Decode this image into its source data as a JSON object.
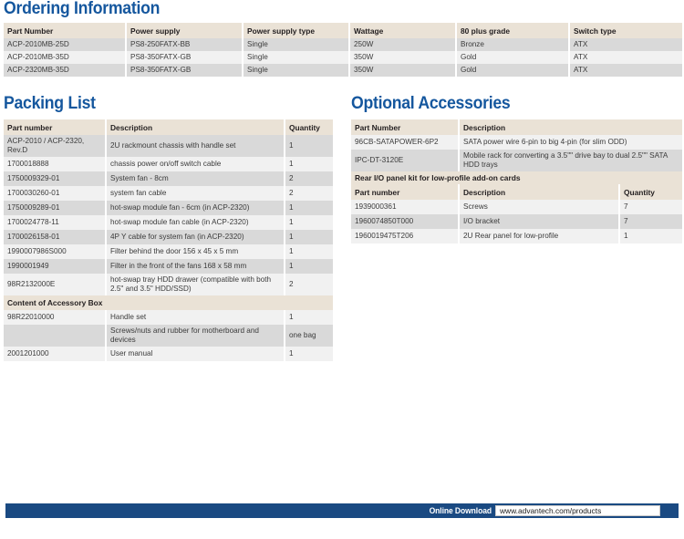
{
  "ordering": {
    "title": "Ordering Information",
    "columns": [
      "Part Number",
      "Power supply",
      "Power supply type",
      "Wattage",
      "80 plus grade",
      "Switch type"
    ],
    "rows": [
      [
        "ACP-2010MB-25D",
        "PS8-250FATX-BB",
        "Single",
        "250W",
        "Bronze",
        "ATX"
      ],
      [
        "ACP-2010MB-35D",
        "PS8-350FATX-GB",
        "Single",
        "350W",
        "Gold",
        "ATX"
      ],
      [
        "ACP-2320MB-35D",
        "PS8-350FATX-GB",
        "Single",
        "350W",
        "Gold",
        "ATX"
      ]
    ]
  },
  "packing": {
    "title": "Packing List",
    "columns": [
      "Part number",
      "Description",
      "Quantity"
    ],
    "rows": [
      [
        "ACP-2010 / ACP-2320, Rev.D",
        "2U rackmount chassis with handle set",
        "1"
      ],
      [
        "1700018888",
        "chassis power on/off switch cable",
        "1"
      ],
      [
        "1750009329-01",
        "System fan - 8cm",
        "2"
      ],
      [
        "1700030260-01",
        "system fan cable",
        "2"
      ],
      [
        "1750009289-01",
        "hot-swap module fan - 6cm (in ACP-2320)",
        "1"
      ],
      [
        "1700024778-11",
        "hot-swap module fan cable (in ACP-2320)",
        "1"
      ],
      [
        "1700026158-01",
        "4P Y cable for system fan (in ACP-2320)",
        "1"
      ],
      [
        "1990007986S000",
        "Filter behind the door 156 x 45 x 5 mm",
        "1"
      ],
      [
        "1990001949",
        "Filter in the front of the fans 168 x 58 mm",
        "1"
      ],
      [
        "98R2132000E",
        "hot-swap tray HDD drawer (compatible with both 2.5\" and 3.5\" HDD/SSD)",
        "2"
      ]
    ],
    "accessory_box_title": "Content of Accessory Box",
    "accessory_rows": [
      [
        "98R22010000",
        "Handle set",
        "1"
      ],
      [
        "",
        "Screws/nuts and rubber for motherboard and devices",
        "one bag"
      ],
      [
        "2001201000",
        "User manual",
        "1"
      ]
    ]
  },
  "optional": {
    "title": "Optional Accessories",
    "columns": [
      "Part Number",
      "Description"
    ],
    "rows": [
      [
        "96CB-SATAPOWER-6P2",
        "SATA power wire 6-pin to big 4-pin (for slim ODD)"
      ],
      [
        "IPC-DT-3120E",
        "Mobile rack for converting a 3.5\"\" drive bay to dual 2.5\"\" SATA HDD trays"
      ]
    ],
    "rear_kit_title": "Rear I/O panel kit for low-profile add-on cards",
    "rear_columns": [
      "Part number",
      "Description",
      "Quantity"
    ],
    "rear_rows": [
      [
        "1939000361",
        "Screws",
        "7"
      ],
      [
        "1960074850T000",
        "I/O bracket",
        "7"
      ],
      [
        "1960019475T206",
        "2U Rear panel for low-profile",
        "1"
      ]
    ]
  },
  "footer": {
    "label": "Online Download",
    "url": "www.advantech.com/products"
  },
  "colors": {
    "heading_blue": "#15579e",
    "footer_blue": "#1a4a82",
    "table_header_beige": "#eae2d6",
    "row_odd": "#d9d9d9",
    "row_even": "#f1f1f1"
  }
}
